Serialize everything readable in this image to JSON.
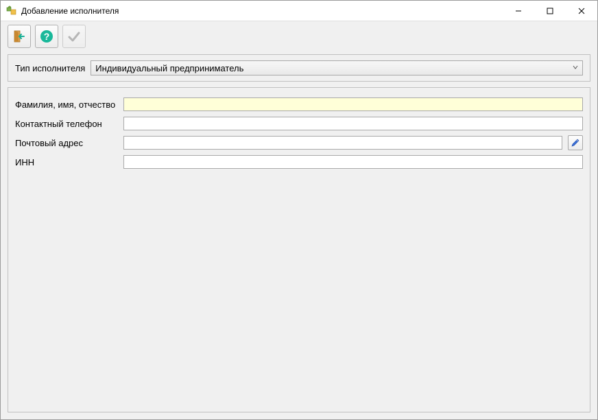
{
  "window": {
    "title": "Добавление исполнителя"
  },
  "toolbar": {
    "exit_icon": "exit",
    "help_icon": "help",
    "confirm_icon": "check"
  },
  "type_section": {
    "label": "Тип исполнителя",
    "selected": "Индивидуальный предприниматель"
  },
  "form": {
    "fields": [
      {
        "label": "Фамилия, имя, отчество",
        "value": "",
        "highlight": true,
        "has_edit_btn": false
      },
      {
        "label": "Контактный телефон",
        "value": "",
        "highlight": false,
        "has_edit_btn": false
      },
      {
        "label": "Почтовый адрес",
        "value": "",
        "highlight": false,
        "has_edit_btn": true
      },
      {
        "label": "ИНН",
        "value": "",
        "highlight": false,
        "has_edit_btn": false
      }
    ]
  }
}
